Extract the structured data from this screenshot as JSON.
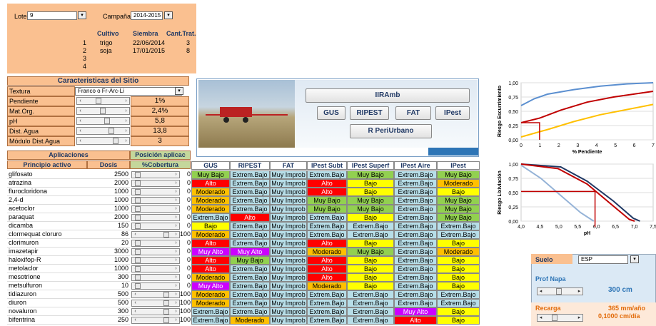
{
  "top": {
    "lote_label": "Lote",
    "lote_value": "9",
    "campana_label": "Campaña",
    "campana_value": "2014-2015",
    "col_cultivo": "Cultivo",
    "col_siembra": "Siembra",
    "col_cant": "Cant.Trat.",
    "rows": [
      {
        "n": "1",
        "cultivo": "trigo",
        "siembra": "22/06/2014",
        "cant": "3"
      },
      {
        "n": "2",
        "cultivo": "soja",
        "siembra": "17/01/2015",
        "cant": "8"
      },
      {
        "n": "3",
        "cultivo": "",
        "siembra": "",
        "cant": ""
      },
      {
        "n": "4",
        "cultivo": "",
        "siembra": "",
        "cant": ""
      }
    ]
  },
  "site": {
    "title": "Caracteristicas del Sitio",
    "rows": [
      {
        "label": "Textura",
        "value": "Franco o Fr-Arc-Li"
      },
      {
        "label": "Pendiente",
        "value": "1%"
      },
      {
        "label": "Mat.Org.",
        "value": "2,4%"
      },
      {
        "label": "pH",
        "value": "5,8"
      },
      {
        "label": "Dist. Agua",
        "value": "13,8"
      },
      {
        "label": "Módulo Dist.Agua",
        "value": "3"
      }
    ]
  },
  "buttons": {
    "iirramb": "IIRAmb",
    "gus": "GUS",
    "ripest": "RIPEST",
    "fat": "FAT",
    "ipest": "IPest",
    "periurbano": "R PeriUrbano"
  },
  "table": {
    "aplicaciones": "Aplicaciones",
    "posicion": "Posición aplicac",
    "principio": "Principio activo",
    "dosis": "Dosis",
    "cobertura": "%Cobertura",
    "cols": [
      "GUS",
      "RIPEST",
      "FAT",
      "IPest Subt",
      "IPest Superf",
      "IPest Aire",
      "IPest"
    ],
    "rows": [
      {
        "name": "glifosato",
        "dosis": "2500",
        "cob": "0",
        "v": [
          "Muy Bajo",
          "Extrem.Bajo",
          "Muy Improb",
          "Extrem.Bajo",
          "Muy Bajo",
          "Extrem.Bajo",
          "Muy Bajo"
        ]
      },
      {
        "name": "atrazina",
        "dosis": "2000",
        "cob": "0",
        "v": [
          "Alto",
          "Extrem.Bajo",
          "Muy Improb",
          "Alto",
          "Bajo",
          "Extrem.Bajo",
          "Moderado"
        ]
      },
      {
        "name": "flurocloridona",
        "dosis": "1000",
        "cob": "0",
        "v": [
          "Moderado",
          "Extrem.Bajo",
          "Muy Improb",
          "Alto",
          "Bajo",
          "Extrem.Bajo",
          "Bajo"
        ]
      },
      {
        "name": "2,4-d",
        "dosis": "1000",
        "cob": "0",
        "v": [
          "Moderado",
          "Extrem.Bajo",
          "Muy Improb",
          "Muy Bajo",
          "Muy Bajo",
          "Extrem.Bajo",
          "Muy Bajo"
        ]
      },
      {
        "name": "acetoclor",
        "dosis": "1000",
        "cob": "0",
        "v": [
          "Moderado",
          "Extrem.Bajo",
          "Muy Improb",
          "Muy Bajo",
          "Muy Bajo",
          "Extrem.Bajo",
          "Muy Bajo"
        ]
      },
      {
        "name": "paraquat",
        "dosis": "2000",
        "cob": "0",
        "v": [
          "Extrem.Bajo",
          "Alto",
          "Muy Improb",
          "Extrem.Bajo",
          "Bajo",
          "Extrem.Bajo",
          "Muy Bajo"
        ]
      },
      {
        "name": "dicamba",
        "dosis": "150",
        "cob": "0",
        "v": [
          "Bajo",
          "Extrem.Bajo",
          "Muy Improb",
          "Extrem.Bajo",
          "Extrem.Bajo",
          "Extrem.Bajo",
          "Extrem.Bajo"
        ]
      },
      {
        "name": "clormequat cloruro",
        "dosis": "86",
        "cob": "100",
        "v": [
          "Moderado",
          "Extrem.Bajo",
          "Muy Improb",
          "Extrem.Bajo",
          "Extrem.Bajo",
          "Extrem.Bajo",
          "Extrem.Bajo"
        ]
      },
      {
        "name": "clorimuron",
        "dosis": "20",
        "cob": "0",
        "v": [
          "Alto",
          "Extrem.Bajo",
          "Muy Improb",
          "Alto",
          "Bajo",
          "Extrem.Bajo",
          "Bajo"
        ]
      },
      {
        "name": "imazetapir",
        "dosis": "3000",
        "cob": "0",
        "v": [
          "Muy Alto",
          "Muy Alto",
          "Muy Improb",
          "Moderado",
          "Muy Bajo",
          "Extrem.Bajo",
          "Moderado"
        ]
      },
      {
        "name": "haloxifop-R",
        "dosis": "1000",
        "cob": "0",
        "v": [
          "Alto",
          "Muy Bajo",
          "Muy Improb",
          "Alto",
          "Bajo",
          "Extrem.Bajo",
          "Bajo"
        ]
      },
      {
        "name": "metolaclor",
        "dosis": "1000",
        "cob": "0",
        "v": [
          "Alto",
          "Extrem.Bajo",
          "Muy Improb",
          "Alto",
          "Bajo",
          "Extrem.Bajo",
          "Bajo"
        ]
      },
      {
        "name": "mesotrione",
        "dosis": "300",
        "cob": "0",
        "v": [
          "Moderado",
          "Extrem.Bajo",
          "Muy Improb",
          "Alto",
          "Bajo",
          "Extrem.Bajo",
          "Bajo"
        ]
      },
      {
        "name": "metsulfuron",
        "dosis": "10",
        "cob": "0",
        "v": [
          "Muy Alto",
          "Extrem.Bajo",
          "Muy Improb",
          "Moderado",
          "Bajo",
          "Extrem.Bajo",
          "Bajo"
        ]
      },
      {
        "name": "tidiazuron",
        "dosis": "500",
        "cob": "100",
        "v": [
          "Moderado",
          "Extrem.Bajo",
          "Muy Improb",
          "Extrem.Bajo",
          "Extrem.Bajo",
          "Extrem.Bajo",
          "Extrem.Bajo"
        ]
      },
      {
        "name": "diuron",
        "dosis": "500",
        "cob": "100",
        "v": [
          "Moderado",
          "Extrem.Bajo",
          "Muy Improb",
          "Extrem.Bajo",
          "Extrem.Bajo",
          "Extrem.Bajo",
          "Extrem.Bajo"
        ]
      },
      {
        "name": "novaluron",
        "dosis": "300",
        "cob": "100",
        "v": [
          "Extrem.Bajo",
          "Extrem.Bajo",
          "Muy Improb",
          "Extrem.Bajo",
          "Extrem.Bajo",
          "Muy Alto",
          "Bajo"
        ]
      },
      {
        "name": "bifentrina",
        "dosis": "250",
        "cob": "100",
        "v": [
          "Extrem.Bajo",
          "Moderado",
          "Muy Improb",
          "Extrem.Bajo",
          "Extrem.Bajo",
          "Alto",
          "Bajo"
        ]
      }
    ]
  },
  "colors": {
    "Muy Bajo": "#92d050",
    "Extrem.Bajo": "#b7dee8",
    "Alto": "#ff0000",
    "Moderado": "#ffc000",
    "Bajo": "#ffff00",
    "Muy Improb": "#b7dee8",
    "Muy Alto": "#cc00ff"
  },
  "chart1": {
    "ylabel": "Riesgo Escurrimiento",
    "xlabel": "% Pendiente",
    "yticks": [
      "0,00",
      "0,25",
      "0,50",
      "0,75",
      "1,00"
    ],
    "xticks": [
      "0",
      "1",
      "2",
      "3",
      "4",
      "5",
      "6",
      "7"
    ]
  },
  "chart2": {
    "ylabel": "Riesgo Lixiviación",
    "xlabel": "pH",
    "yticks": [
      "0,00",
      "0,25",
      "0,50",
      "0,75",
      "1,00"
    ],
    "xticks": [
      "4,0",
      "4,5",
      "5,0",
      "5,5",
      "6,0",
      "6,5",
      "7,0",
      "7,5"
    ]
  },
  "suelo": {
    "label": "Suelo",
    "value": "ESP",
    "prof_label": "Prof Napa",
    "prof_value": "300 cm",
    "recarga_label": "Recarga",
    "recarga_value1": "365 mm/año",
    "recarga_value2": "0,1000 cm/día"
  }
}
